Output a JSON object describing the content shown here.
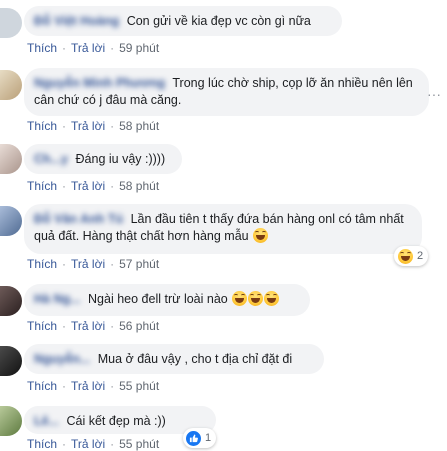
{
  "actions": {
    "like": "Thích",
    "reply": "Trả lời"
  },
  "comments": [
    {
      "text": "Con gửi về kia đẹp vc còn gì nữa",
      "time": "59 phút",
      "author_blurred": "Đỗ Việt Hoàng",
      "avatar_color": "#cfd6dd"
    },
    {
      "text": "Trong lúc chờ ship, cọp lỡ ăn nhiều nên lên cân chứ có j đâu mà căng.",
      "time": "58 phút",
      "author_blurred": "Nguyễn Minh Phương",
      "avatar_color": "#d8c8a8"
    },
    {
      "text": "Đáng iu vậy :))))",
      "time": "58 phút",
      "author_blurred": "Ch...y",
      "avatar_color": "#c9b8b0"
    },
    {
      "text": "Lần đầu tiên t thấy đứa bán hàng onl có tâm nhất quả đất. Hàng thật chất hơn hàng mẫu",
      "time": "57 phút",
      "author_blurred": "Đỗ Văn Anh Tú",
      "avatar_color": "#7d94b8",
      "reaction_count": "2",
      "reaction_icon": "laughing-emoji"
    },
    {
      "text": "Ngài heo đell trừ loài nào",
      "time": "56 phút",
      "author_blurred": "Hà Ng...",
      "avatar_color": "#4a3a3a"
    },
    {
      "text": "Mua ở đâu vậy , cho t địa chỉ đặt đi",
      "time": "55 phút",
      "author_blurred": "Nguyễn...",
      "avatar_color": "#2b2b2b"
    },
    {
      "text": "Cái kết đẹp mà :))",
      "time": "55 phút",
      "author_blurred": "Lê...",
      "avatar_color": "#8aa26f",
      "reaction_count": "1",
      "reaction_icon": "like-icon"
    }
  ]
}
